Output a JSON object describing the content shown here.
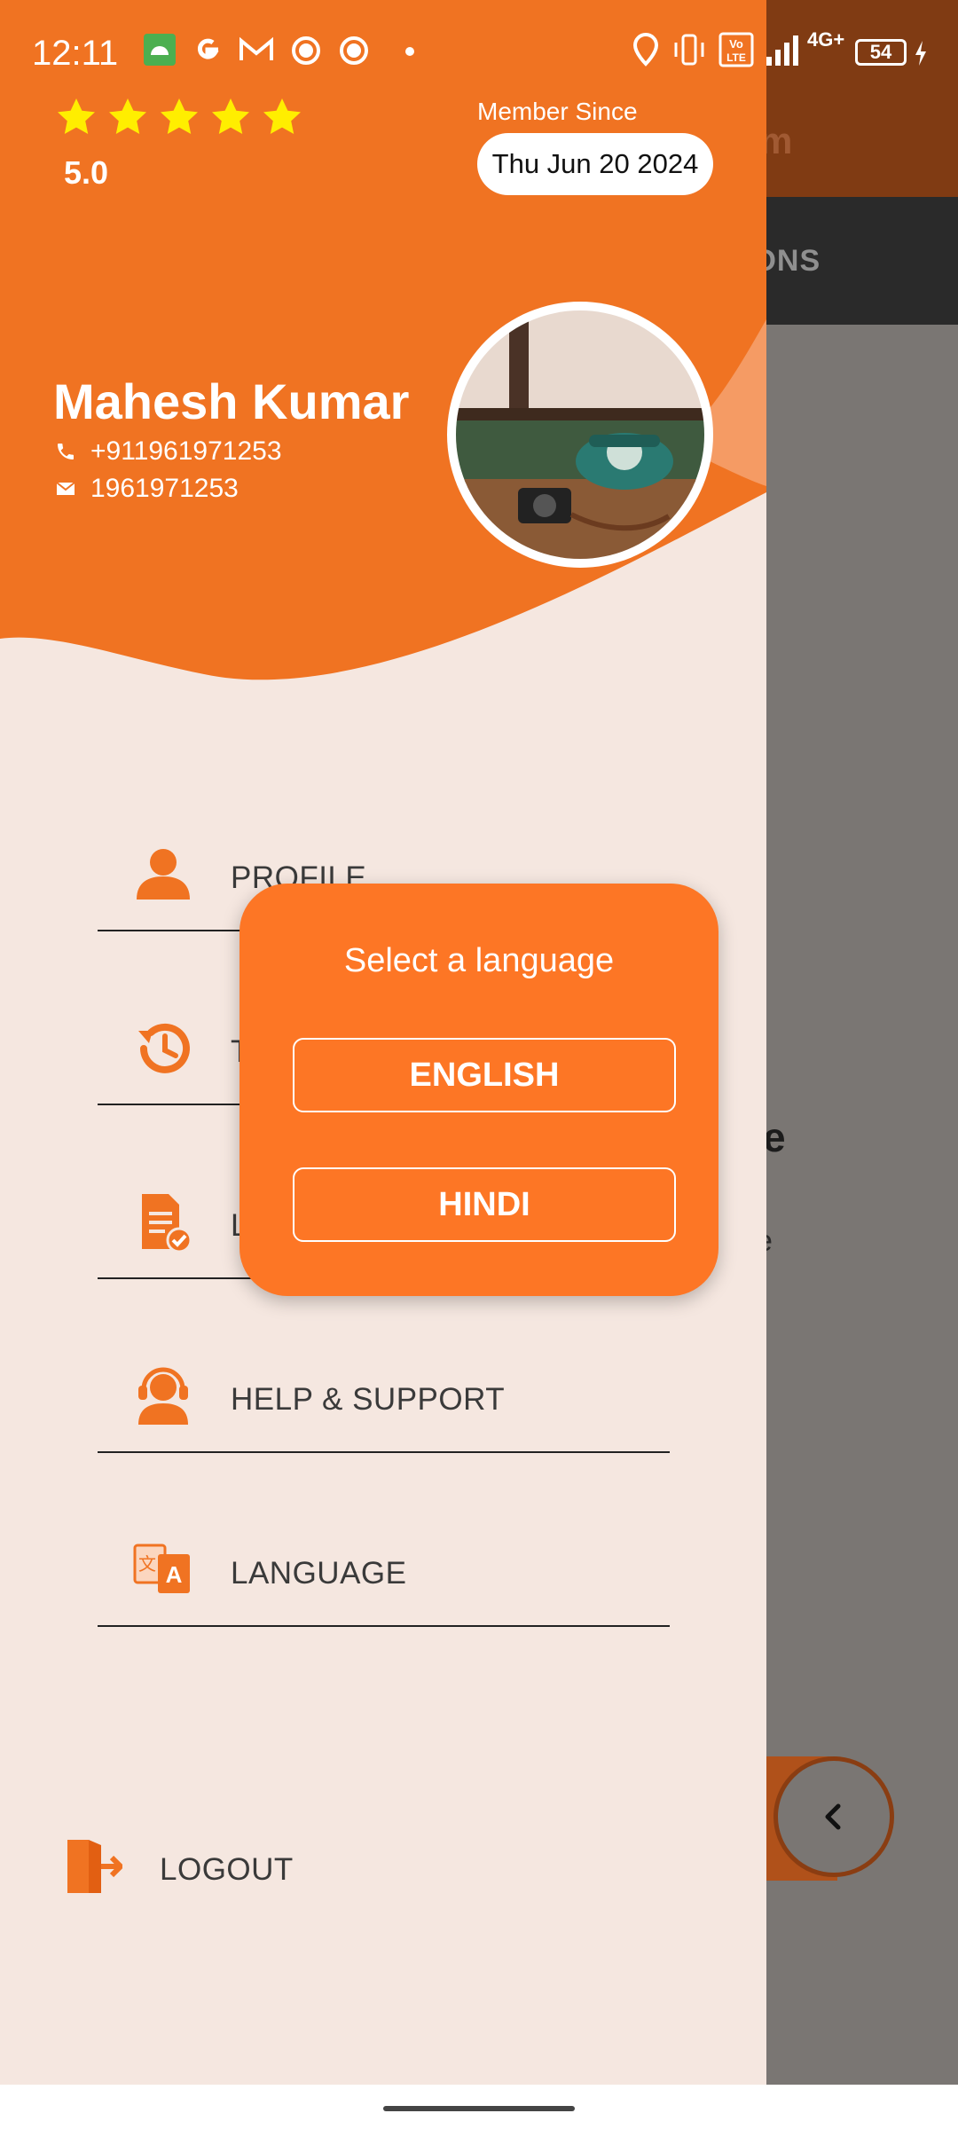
{
  "status_bar": {
    "time": "12:11",
    "network": "4G+",
    "battery": "54",
    "volte": "Vo LTE"
  },
  "background_app": {
    "header_fragment": "m",
    "tab_fragment": "IONS",
    "text_fragment_1": "e",
    "text_fragment_2": "e"
  },
  "drawer": {
    "rating": {
      "stars": 5,
      "value": "5.0"
    },
    "member_since": {
      "label": "Member Since",
      "date": "Thu Jun 20 2024"
    },
    "user": {
      "name": "Mahesh Kumar",
      "phone": "+911961971253",
      "email": "1961971253"
    },
    "menu": [
      {
        "label": "PROFILE",
        "icon": "person-icon"
      },
      {
        "label": "T",
        "icon": "history-icon"
      },
      {
        "label": "L",
        "icon": "document-check-icon"
      },
      {
        "label": "HELP & SUPPORT",
        "icon": "headset-icon"
      },
      {
        "label": "LANGUAGE",
        "icon": "translate-icon"
      }
    ],
    "logout": {
      "label": "LOGOUT",
      "icon": "logout-icon"
    }
  },
  "dialog": {
    "title": "Select a language",
    "options": [
      "ENGLISH",
      "HINDI"
    ]
  },
  "colors": {
    "primary": "#f07322",
    "dialog": "#fd7625",
    "drawer_bg": "#f5e7e0",
    "star": "#ffee00"
  }
}
